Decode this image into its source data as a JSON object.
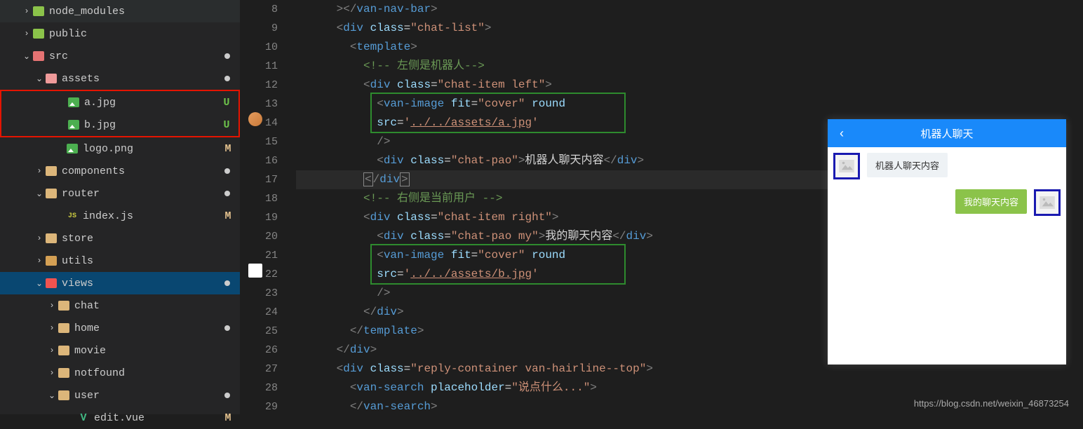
{
  "sidebar": {
    "items": [
      {
        "label": "node_modules",
        "icon": "nm",
        "chev": "›",
        "indent": 30,
        "status": ""
      },
      {
        "label": "public",
        "icon": "folder-green",
        "chev": "›",
        "indent": 30,
        "status": ""
      },
      {
        "label": "src",
        "icon": "folder-red",
        "chev": "⌄",
        "indent": 30,
        "status": "dot"
      },
      {
        "label": "assets",
        "icon": "folder-assets",
        "chev": "⌄",
        "indent": 48,
        "status": "dot"
      },
      {
        "label": "a.jpg",
        "icon": "img",
        "chev": "",
        "indent": 78,
        "status": "U",
        "redbox": true
      },
      {
        "label": "b.jpg",
        "icon": "img",
        "chev": "",
        "indent": 78,
        "status": "U",
        "redbox": true
      },
      {
        "label": "logo.png",
        "icon": "img",
        "chev": "",
        "indent": 78,
        "status": "M"
      },
      {
        "label": "components",
        "icon": "folder",
        "chev": "›",
        "indent": 48,
        "status": "dot"
      },
      {
        "label": "router",
        "icon": "folder",
        "chev": "⌄",
        "indent": 48,
        "status": "dot"
      },
      {
        "label": "index.js",
        "icon": "js",
        "chev": "",
        "indent": 78,
        "status": "M"
      },
      {
        "label": "store",
        "icon": "folder",
        "chev": "›",
        "indent": 48,
        "status": ""
      },
      {
        "label": "utils",
        "icon": "folder-utils",
        "chev": "›",
        "indent": 48,
        "status": ""
      },
      {
        "label": "views",
        "icon": "folder-views",
        "chev": "⌄",
        "indent": 48,
        "status": "dot",
        "active": true
      },
      {
        "label": "chat",
        "icon": "folder",
        "chev": "›",
        "indent": 66,
        "status": ""
      },
      {
        "label": "home",
        "icon": "folder",
        "chev": "›",
        "indent": 66,
        "status": "dot"
      },
      {
        "label": "movie",
        "icon": "folder",
        "chev": "›",
        "indent": 66,
        "status": ""
      },
      {
        "label": "notfound",
        "icon": "folder",
        "chev": "›",
        "indent": 66,
        "status": ""
      },
      {
        "label": "user",
        "icon": "folder",
        "chev": "⌄",
        "indent": 66,
        "status": "dot"
      },
      {
        "label": "edit.vue",
        "icon": "vue",
        "chev": "",
        "indent": 94,
        "status": "M"
      }
    ]
  },
  "editor": {
    "line_start": 8,
    "line_end": 29,
    "lines": [
      {
        "n": 8,
        "tokens": [
          [
            "      ",
            "plain"
          ],
          [
            "><",
            "tag-bracket"
          ],
          [
            "/",
            "tag-bracket"
          ],
          [
            "van-nav-bar",
            "tag-name"
          ],
          [
            ">",
            "tag-bracket"
          ]
        ]
      },
      {
        "n": 9,
        "tokens": [
          [
            "      ",
            "plain"
          ],
          [
            "<",
            "tag-bracket"
          ],
          [
            "div",
            "tag-name"
          ],
          [
            " ",
            "plain"
          ],
          [
            "class",
            "attr-name"
          ],
          [
            "=",
            "plain"
          ],
          [
            "\"chat-list\"",
            "attr-value"
          ],
          [
            ">",
            "tag-bracket"
          ]
        ]
      },
      {
        "n": 10,
        "tokens": [
          [
            "        ",
            "plain"
          ],
          [
            "<",
            "tag-bracket"
          ],
          [
            "template",
            "tag-name"
          ],
          [
            ">",
            "tag-bracket"
          ]
        ]
      },
      {
        "n": 11,
        "tokens": [
          [
            "          ",
            "plain"
          ],
          [
            "<!-- 左侧是机器人-->",
            "comment"
          ]
        ]
      },
      {
        "n": 12,
        "tokens": [
          [
            "          ",
            "plain"
          ],
          [
            "<",
            "tag-bracket"
          ],
          [
            "div",
            "tag-name"
          ],
          [
            " ",
            "plain"
          ],
          [
            "class",
            "attr-name"
          ],
          [
            "=",
            "plain"
          ],
          [
            "\"chat-item left\"",
            "attr-value"
          ],
          [
            ">",
            "tag-bracket"
          ]
        ]
      },
      {
        "n": 13,
        "tokens": [
          [
            "            ",
            "plain"
          ],
          [
            "<",
            "tag-bracket"
          ],
          [
            "van-image",
            "tag-name"
          ],
          [
            " ",
            "plain"
          ],
          [
            "fit",
            "attr-name"
          ],
          [
            "=",
            "plain"
          ],
          [
            "\"cover\"",
            "attr-value"
          ],
          [
            " ",
            "plain"
          ],
          [
            "round",
            "attr-name"
          ]
        ]
      },
      {
        "n": 14,
        "tokens": [
          [
            "            ",
            "plain"
          ],
          [
            "src",
            "attr-name"
          ],
          [
            "=",
            "plain"
          ],
          [
            "'",
            "attr-value"
          ],
          [
            "../../assets/a.jpg",
            "attr-value underline"
          ],
          [
            "'",
            "attr-value"
          ]
        ]
      },
      {
        "n": 15,
        "tokens": [
          [
            "            ",
            "plain"
          ],
          [
            "/>",
            "tag-bracket"
          ]
        ]
      },
      {
        "n": 16,
        "tokens": [
          [
            "            ",
            "plain"
          ],
          [
            "<",
            "tag-bracket"
          ],
          [
            "div",
            "tag-name"
          ],
          [
            " ",
            "plain"
          ],
          [
            "class",
            "attr-name"
          ],
          [
            "=",
            "plain"
          ],
          [
            "\"chat-pao\"",
            "attr-value"
          ],
          [
            ">",
            "tag-bracket"
          ],
          [
            "机器人聊天内容",
            "plain"
          ],
          [
            "</",
            "tag-bracket"
          ],
          [
            "div",
            "tag-name"
          ],
          [
            ">",
            "tag-bracket"
          ]
        ]
      },
      {
        "n": 17,
        "tokens": [
          [
            "          ",
            "plain"
          ],
          [
            "<",
            "tag-bracket cursor-box"
          ],
          [
            "/",
            "tag-bracket"
          ],
          [
            "div",
            "tag-name"
          ],
          [
            ">",
            "tag-bracket cursor-box"
          ]
        ],
        "hl": true
      },
      {
        "n": 18,
        "tokens": [
          [
            "          ",
            "plain"
          ],
          [
            "<!-- 右侧是当前用户 -->",
            "comment"
          ]
        ]
      },
      {
        "n": 19,
        "tokens": [
          [
            "          ",
            "plain"
          ],
          [
            "<",
            "tag-bracket"
          ],
          [
            "div",
            "tag-name"
          ],
          [
            " ",
            "plain"
          ],
          [
            "class",
            "attr-name"
          ],
          [
            "=",
            "plain"
          ],
          [
            "\"chat-item right\"",
            "attr-value"
          ],
          [
            ">",
            "tag-bracket"
          ]
        ]
      },
      {
        "n": 20,
        "tokens": [
          [
            "            ",
            "plain"
          ],
          [
            "<",
            "tag-bracket"
          ],
          [
            "div",
            "tag-name"
          ],
          [
            " ",
            "plain"
          ],
          [
            "class",
            "attr-name"
          ],
          [
            "=",
            "plain"
          ],
          [
            "\"chat-pao my\"",
            "attr-value"
          ],
          [
            ">",
            "tag-bracket"
          ],
          [
            "我的聊天内容",
            "plain"
          ],
          [
            "</",
            "tag-bracket"
          ],
          [
            "div",
            "tag-name"
          ],
          [
            ">",
            "tag-bracket"
          ]
        ]
      },
      {
        "n": 21,
        "tokens": [
          [
            "            ",
            "plain"
          ],
          [
            "<",
            "tag-bracket"
          ],
          [
            "van-image",
            "tag-name"
          ],
          [
            " ",
            "plain"
          ],
          [
            "fit",
            "attr-name"
          ],
          [
            "=",
            "plain"
          ],
          [
            "\"cover\"",
            "attr-value"
          ],
          [
            " ",
            "plain"
          ],
          [
            "round",
            "attr-name"
          ]
        ]
      },
      {
        "n": 22,
        "tokens": [
          [
            "            ",
            "plain"
          ],
          [
            "src",
            "attr-name"
          ],
          [
            "=",
            "plain"
          ],
          [
            "'",
            "attr-value"
          ],
          [
            "../../assets/b.jpg",
            "attr-value underline"
          ],
          [
            "'",
            "attr-value"
          ]
        ]
      },
      {
        "n": 23,
        "tokens": [
          [
            "            ",
            "plain"
          ],
          [
            "/>",
            "tag-bracket"
          ]
        ]
      },
      {
        "n": 24,
        "tokens": [
          [
            "          ",
            "plain"
          ],
          [
            "</",
            "tag-bracket"
          ],
          [
            "div",
            "tag-name"
          ],
          [
            ">",
            "tag-bracket"
          ]
        ]
      },
      {
        "n": 25,
        "tokens": [
          [
            "        ",
            "plain"
          ],
          [
            "</",
            "tag-bracket"
          ],
          [
            "template",
            "tag-name"
          ],
          [
            ">",
            "tag-bracket"
          ]
        ]
      },
      {
        "n": 26,
        "tokens": [
          [
            "      ",
            "plain"
          ],
          [
            "</",
            "tag-bracket"
          ],
          [
            "div",
            "tag-name"
          ],
          [
            ">",
            "tag-bracket"
          ]
        ]
      },
      {
        "n": 27,
        "tokens": [
          [
            "      ",
            "plain"
          ],
          [
            "<",
            "tag-bracket"
          ],
          [
            "div",
            "tag-name"
          ],
          [
            " ",
            "plain"
          ],
          [
            "class",
            "attr-name"
          ],
          [
            "=",
            "plain"
          ],
          [
            "\"reply-container van-hairline--top\"",
            "attr-value"
          ],
          [
            ">",
            "tag-bracket"
          ]
        ]
      },
      {
        "n": 28,
        "tokens": [
          [
            "        ",
            "plain"
          ],
          [
            "<",
            "tag-bracket"
          ],
          [
            "van-search",
            "tag-name"
          ],
          [
            " ",
            "plain"
          ],
          [
            "placeholder",
            "attr-name"
          ],
          [
            "=",
            "plain"
          ],
          [
            "\"说点什么...\"",
            "attr-value"
          ],
          [
            ">",
            "tag-bracket"
          ]
        ]
      },
      {
        "n": 29,
        "tokens": [
          [
            "        ",
            "plain"
          ],
          [
            "</",
            "tag-bracket"
          ],
          [
            "van-search",
            "tag-name"
          ],
          [
            ">",
            "tag-bracket"
          ]
        ]
      }
    ]
  },
  "preview": {
    "title": "机器人聊天",
    "bot_msg": "机器人聊天内容",
    "my_msg": "我的聊天内容"
  },
  "watermark": "https://blog.csdn.net/weixin_46873254"
}
